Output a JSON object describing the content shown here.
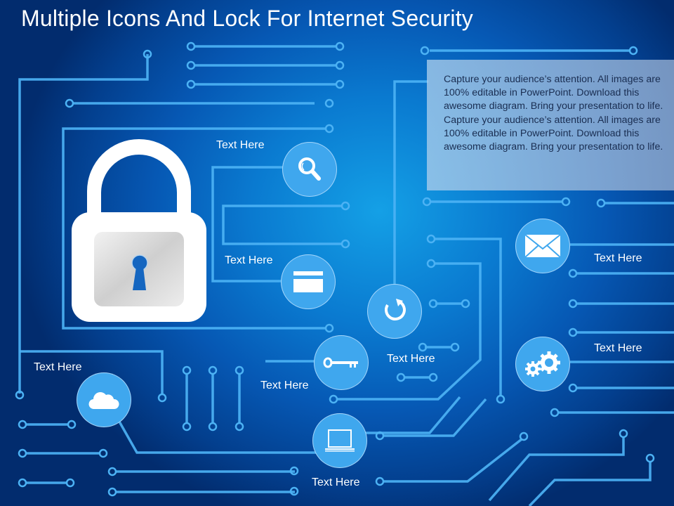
{
  "title": "Multiple Icons And Lock For Internet Security",
  "description": "Capture your audience’s attention. All images are 100% editable in PowerPoint. Download this awesome diagram. Bring your presentation to life. Capture your audience’s attention. All images are 100% editable in PowerPoint. Download this awesome diagram. Bring your presentation to life.",
  "central_icon": "padlock-icon",
  "nodes": [
    {
      "id": "search",
      "icon": "magnifier-icon",
      "label": "Text Here"
    },
    {
      "id": "card",
      "icon": "credit-card-icon",
      "label": "Text Here"
    },
    {
      "id": "refresh",
      "icon": "refresh-icon",
      "label": "Text Here"
    },
    {
      "id": "key",
      "icon": "key-icon",
      "label": "Text Here"
    },
    {
      "id": "cloud",
      "icon": "cloud-icon",
      "label": "Text Here"
    },
    {
      "id": "laptop",
      "icon": "laptop-icon",
      "label": "Text Here"
    },
    {
      "id": "mail",
      "icon": "envelope-icon",
      "label": "Text Here"
    },
    {
      "id": "gears",
      "icon": "gears-icon",
      "label": "Text Here"
    }
  ],
  "colors": {
    "background_center": "#14a0e6",
    "background_edge": "#022c6e",
    "circuit": "#4cb2f4",
    "icon_circle": "#3fa7ee",
    "text": "#ffffff"
  }
}
